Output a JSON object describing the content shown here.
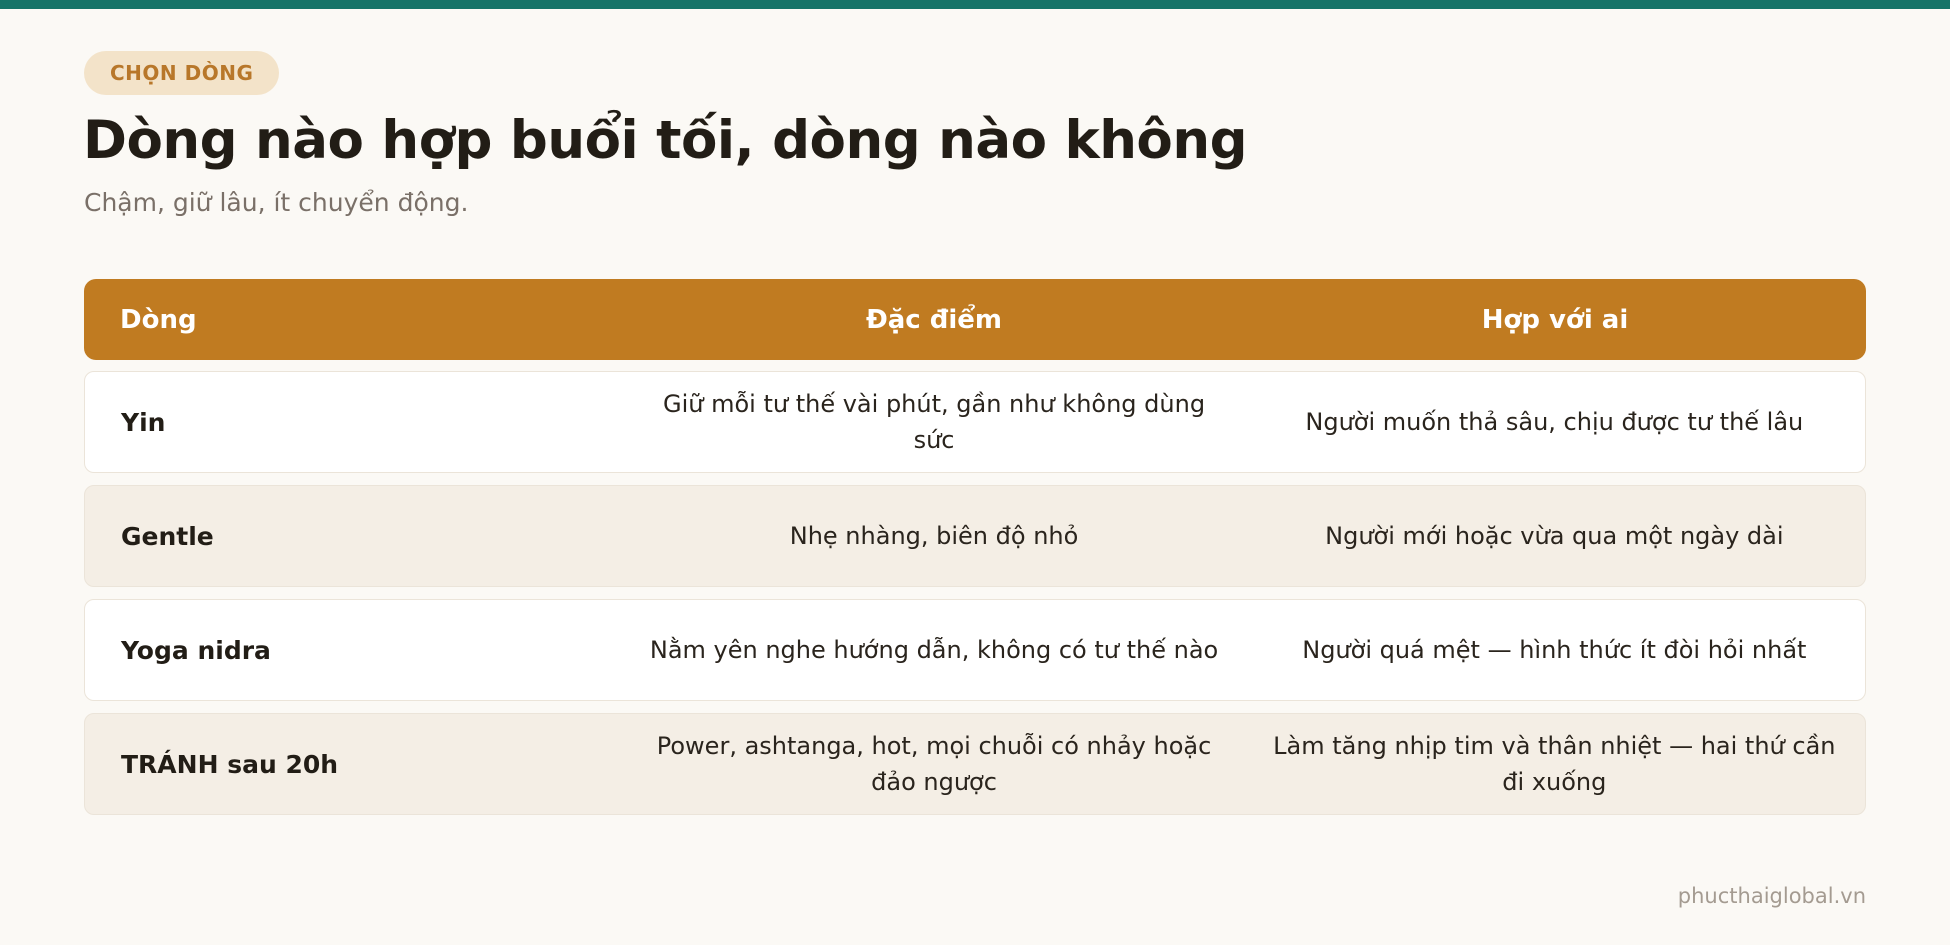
{
  "badge": "CHỌN DÒNG",
  "title": "Dòng nào hợp buổi tối, dòng nào không",
  "subtitle": "Chậm, giữ lâu, ít chuyển động.",
  "table": {
    "headers": [
      "Dòng",
      "Đặc điểm",
      "Hợp với ai"
    ],
    "rows": [
      [
        "Yin",
        "Giữ mỗi tư thế vài phút, gần như không dùng sức",
        "Người muốn thả sâu, chịu được tư thế lâu"
      ],
      [
        "Gentle",
        "Nhẹ nhàng, biên độ nhỏ",
        "Người mới hoặc vừa qua một ngày dài"
      ],
      [
        "Yoga nidra",
        "Nằm yên nghe hướng dẫn, không có tư thế nào",
        "Người quá mệt — hình thức ít đòi hỏi nhất"
      ],
      [
        "TRÁNH sau 20h",
        "Power, ashtanga, hot, mọi chuỗi có nhảy hoặc đảo ngược",
        "Làm tăng nhịp tim và thân nhiệt — hai thứ cần đi xuống"
      ]
    ]
  },
  "footer": "phucthaiglobal.vn",
  "colors": {
    "accent": "#c07b21",
    "top_bar": "#167468",
    "badge_bg": "#f3e3c9",
    "badge_text": "#b8772a",
    "background": "#fbf9f5",
    "row_tint": "#f4eee5"
  }
}
